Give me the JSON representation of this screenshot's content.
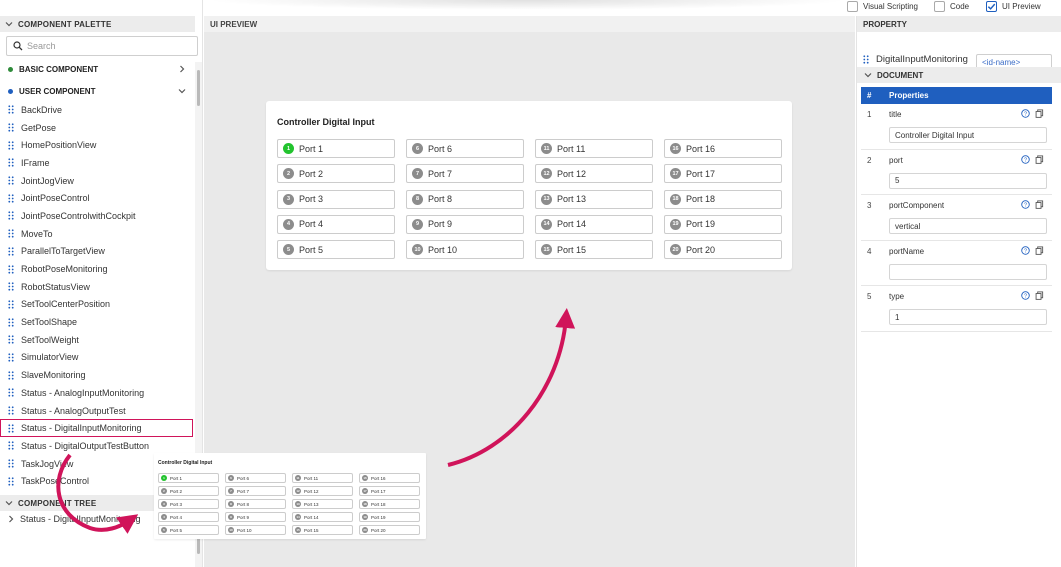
{
  "topbar": {
    "options": [
      {
        "label": "Visual Scripting",
        "checked": false
      },
      {
        "label": "Code",
        "checked": false
      },
      {
        "label": "UI Preview",
        "checked": true
      }
    ]
  },
  "palette": {
    "header": "COMPONENT PALETTE",
    "search_placeholder": "Search",
    "basic_group": "BASIC COMPONENT",
    "user_group": "USER COMPONENT",
    "items": [
      "BackDrive",
      "GetPose",
      "HomePositionView",
      "IFrame",
      "JointJogView",
      "JointPoseControl",
      "JointPoseControlwithCockpit",
      "MoveTo",
      "ParallelToTargetView",
      "RobotPoseMonitoring",
      "RobotStatusView",
      "SetToolCenterPosition",
      "SetToolShape",
      "SetToolWeight",
      "SimulatorView",
      "SlaveMonitoring",
      "Status - AnalogInputMonitoring",
      "Status - AnalogOutputTest",
      "Status - DigitalInputMonitoring",
      "Status - DigitalOutputTestButton",
      "TaskJogView",
      "TaskPoseControl"
    ],
    "tree_header": "COMPONENT TREE",
    "tree_item": "Status - DigitalInputMonitoring"
  },
  "preview": {
    "header": "UI PREVIEW",
    "card_title": "Controller Digital Input",
    "ports": [
      "Port 1",
      "Port 2",
      "Port 3",
      "Port 4",
      "Port 5",
      "Port 6",
      "Port 7",
      "Port 8",
      "Port 9",
      "Port 10",
      "Port 11",
      "Port 12",
      "Port 13",
      "Port 14",
      "Port 15",
      "Port 16",
      "Port 17",
      "Port 18",
      "Port 19",
      "Port 20"
    ],
    "port_numbers": [
      "1",
      "2",
      "3",
      "4",
      "5",
      "6",
      "7",
      "8",
      "9",
      "10",
      "11",
      "12",
      "13",
      "14",
      "15",
      "16",
      "17",
      "18",
      "19",
      "20"
    ],
    "active_port": 1
  },
  "property": {
    "header": "PROPERTY",
    "component_name": "DigitalInputMonitoring",
    "id_placeholder": "<id-name>",
    "document_header": "DOCUMENT",
    "col_index": "#",
    "col_properties": "Properties",
    "rows": [
      {
        "index": "1",
        "name": "title",
        "value": "Controller Digital Input"
      },
      {
        "index": "2",
        "name": "port",
        "value": "5"
      },
      {
        "index": "3",
        "name": "portComponent",
        "value": "vertical"
      },
      {
        "index": "4",
        "name": "portName",
        "value": ""
      },
      {
        "index": "5",
        "name": "type",
        "value": "1"
      }
    ]
  },
  "colors": {
    "accent": "#1f5fbf",
    "active_port": "#22c32e",
    "highlight": "#d0145a",
    "basic_dot": "#2e8b3a",
    "user_dot": "#1f5fbf"
  }
}
